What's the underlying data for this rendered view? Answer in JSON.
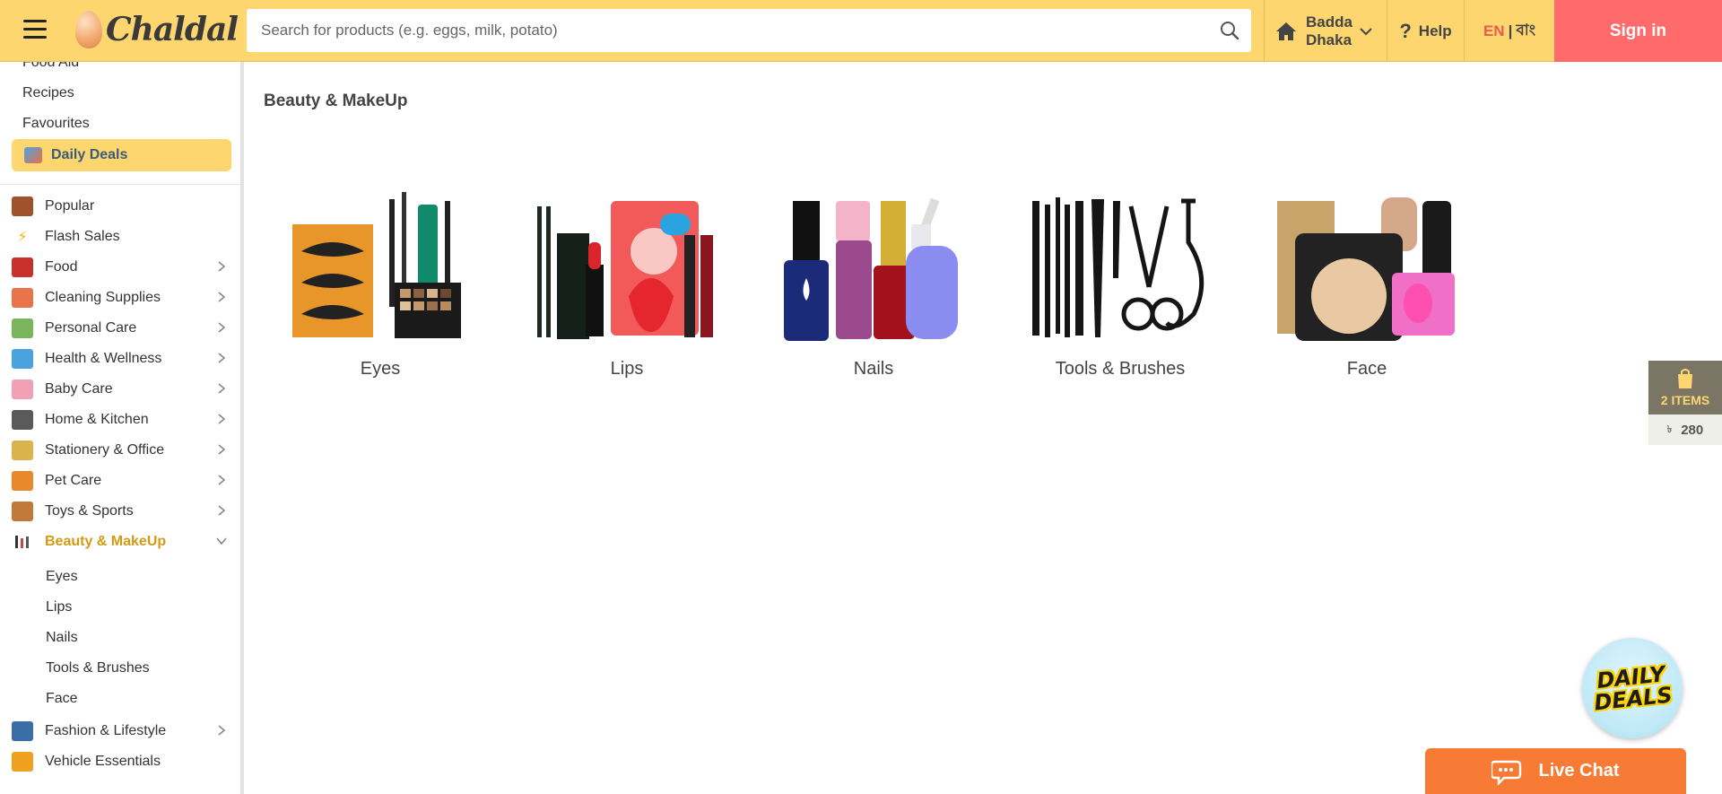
{
  "header": {
    "brand": "Chaldal",
    "search_placeholder": "Search for products (e.g. eggs, milk, potato)",
    "location_line1": "Badda",
    "location_line2": "Dhaka",
    "help_label": "Help",
    "lang_en": "EN",
    "lang_sep": "|",
    "lang_bn": "বাং",
    "signin_label": "Sign in"
  },
  "sidebar": {
    "top_links": [
      "Food Aid",
      "Recipes",
      "Favourites"
    ],
    "daily_deals": "Daily Deals",
    "categories": [
      {
        "label": "Popular",
        "icon": "popular-icon",
        "has_arrow": false
      },
      {
        "label": "Flash Sales",
        "icon": "lightning-icon",
        "has_arrow": false
      },
      {
        "label": "Food",
        "icon": "food-basket-icon",
        "has_arrow": true
      },
      {
        "label": "Cleaning Supplies",
        "icon": "cleaning-icon",
        "has_arrow": true
      },
      {
        "label": "Personal Care",
        "icon": "personal-care-icon",
        "has_arrow": true
      },
      {
        "label": "Health & Wellness",
        "icon": "health-icon",
        "has_arrow": true
      },
      {
        "label": "Baby Care",
        "icon": "baby-care-icon",
        "has_arrow": true
      },
      {
        "label": "Home & Kitchen",
        "icon": "home-kitchen-icon",
        "has_arrow": true
      },
      {
        "label": "Stationery & Office",
        "icon": "stationery-icon",
        "has_arrow": true
      },
      {
        "label": "Pet Care",
        "icon": "pet-care-icon",
        "has_arrow": true
      },
      {
        "label": "Toys & Sports",
        "icon": "toys-icon",
        "has_arrow": true
      },
      {
        "label": "Beauty & MakeUp",
        "icon": "beauty-icon",
        "has_arrow": true,
        "active": true
      }
    ],
    "subcategories": [
      "Eyes",
      "Lips",
      "Nails",
      "Tools & Brushes",
      "Face"
    ],
    "categories_after": [
      {
        "label": "Fashion & Lifestyle",
        "icon": "fashion-icon",
        "has_arrow": true
      },
      {
        "label": "Vehicle Essentials",
        "icon": "vehicle-icon",
        "has_arrow": false
      }
    ]
  },
  "main": {
    "title": "Beauty & MakeUp",
    "tiles": [
      {
        "label": "Eyes"
      },
      {
        "label": "Lips"
      },
      {
        "label": "Nails"
      },
      {
        "label": "Tools & Brushes"
      },
      {
        "label": "Face"
      }
    ]
  },
  "cart": {
    "items_label": "2 ITEMS",
    "currency": "৳",
    "total": "280"
  },
  "daily_deals_bubble": {
    "line1": "DAILY",
    "line2": "DEALS"
  },
  "live_chat": {
    "label": "Live Chat"
  },
  "colors": {
    "header_bg": "#fdd670",
    "signin_bg": "#ff6b6b",
    "active_category": "#d39b14",
    "live_chat_bg": "#f77a35"
  }
}
